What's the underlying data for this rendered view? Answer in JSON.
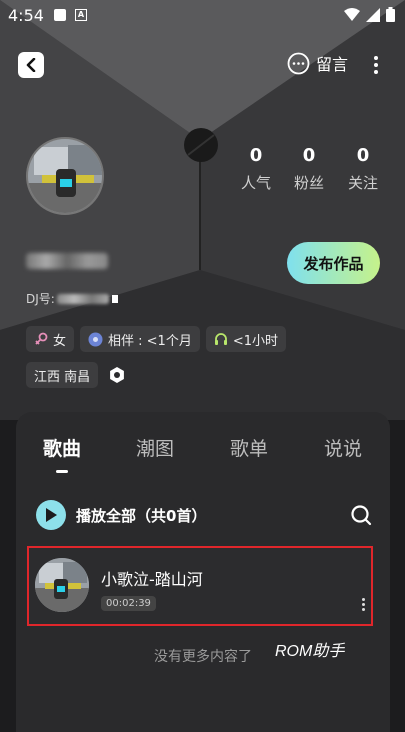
{
  "status_bar": {
    "time": "4:54"
  },
  "header": {
    "message_label": "留言"
  },
  "profile": {
    "dj_id_prefix": "DJ号:",
    "stats": [
      {
        "value": "0",
        "label": "人气"
      },
      {
        "value": "0",
        "label": "粉丝"
      },
      {
        "value": "0",
        "label": "关注"
      }
    ],
    "publish_label": "发布作品",
    "tags": [
      {
        "icon": "female-icon",
        "text": "女"
      },
      {
        "icon": "vinyl-icon",
        "text": "相伴 : <1个月"
      },
      {
        "icon": "headphones-icon",
        "text": "<1小时"
      }
    ],
    "location": "江西 南昌"
  },
  "tabs": [
    "歌曲",
    "潮图",
    "歌单",
    "说说"
  ],
  "active_tab": "歌曲",
  "playlist": {
    "play_all_label": "播放全部（共0首）",
    "songs": [
      {
        "title": "小歌泣-踏山河",
        "duration": "00:02:39"
      }
    ],
    "footer": "没有更多内容了"
  },
  "watermark": "ROM助手",
  "colors": {
    "accent_cyan": "#8de0ea",
    "publish_gradient_start": "#7fe0ee",
    "publish_gradient_end": "#c6f28a",
    "highlight_red": "#e0262b"
  }
}
